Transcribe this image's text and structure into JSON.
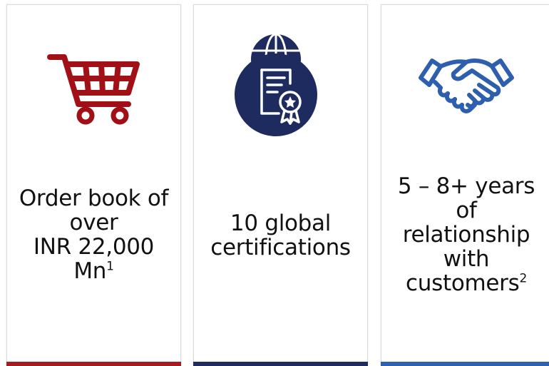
{
  "colors": {
    "red_accent": "#a51d22",
    "navy_accent": "#1d2b5e",
    "blue_accent": "#2f60b1",
    "cart_icon": "#a11016",
    "handshake_icon": "#2e5eae"
  },
  "cards": [
    {
      "icon": "shopping-cart-icon",
      "lines": [
        "Order book of",
        "over",
        "INR 22,000"
      ],
      "last_line": "Mn",
      "footnote": "1"
    },
    {
      "icon": "global-certificate-icon",
      "lines": [
        "10 global",
        "certifications"
      ]
    },
    {
      "icon": "handshake-icon",
      "lines": [
        "5 – 8+ years",
        "of",
        "relationship",
        "with"
      ],
      "last_line": "customers",
      "footnote": "2"
    }
  ]
}
